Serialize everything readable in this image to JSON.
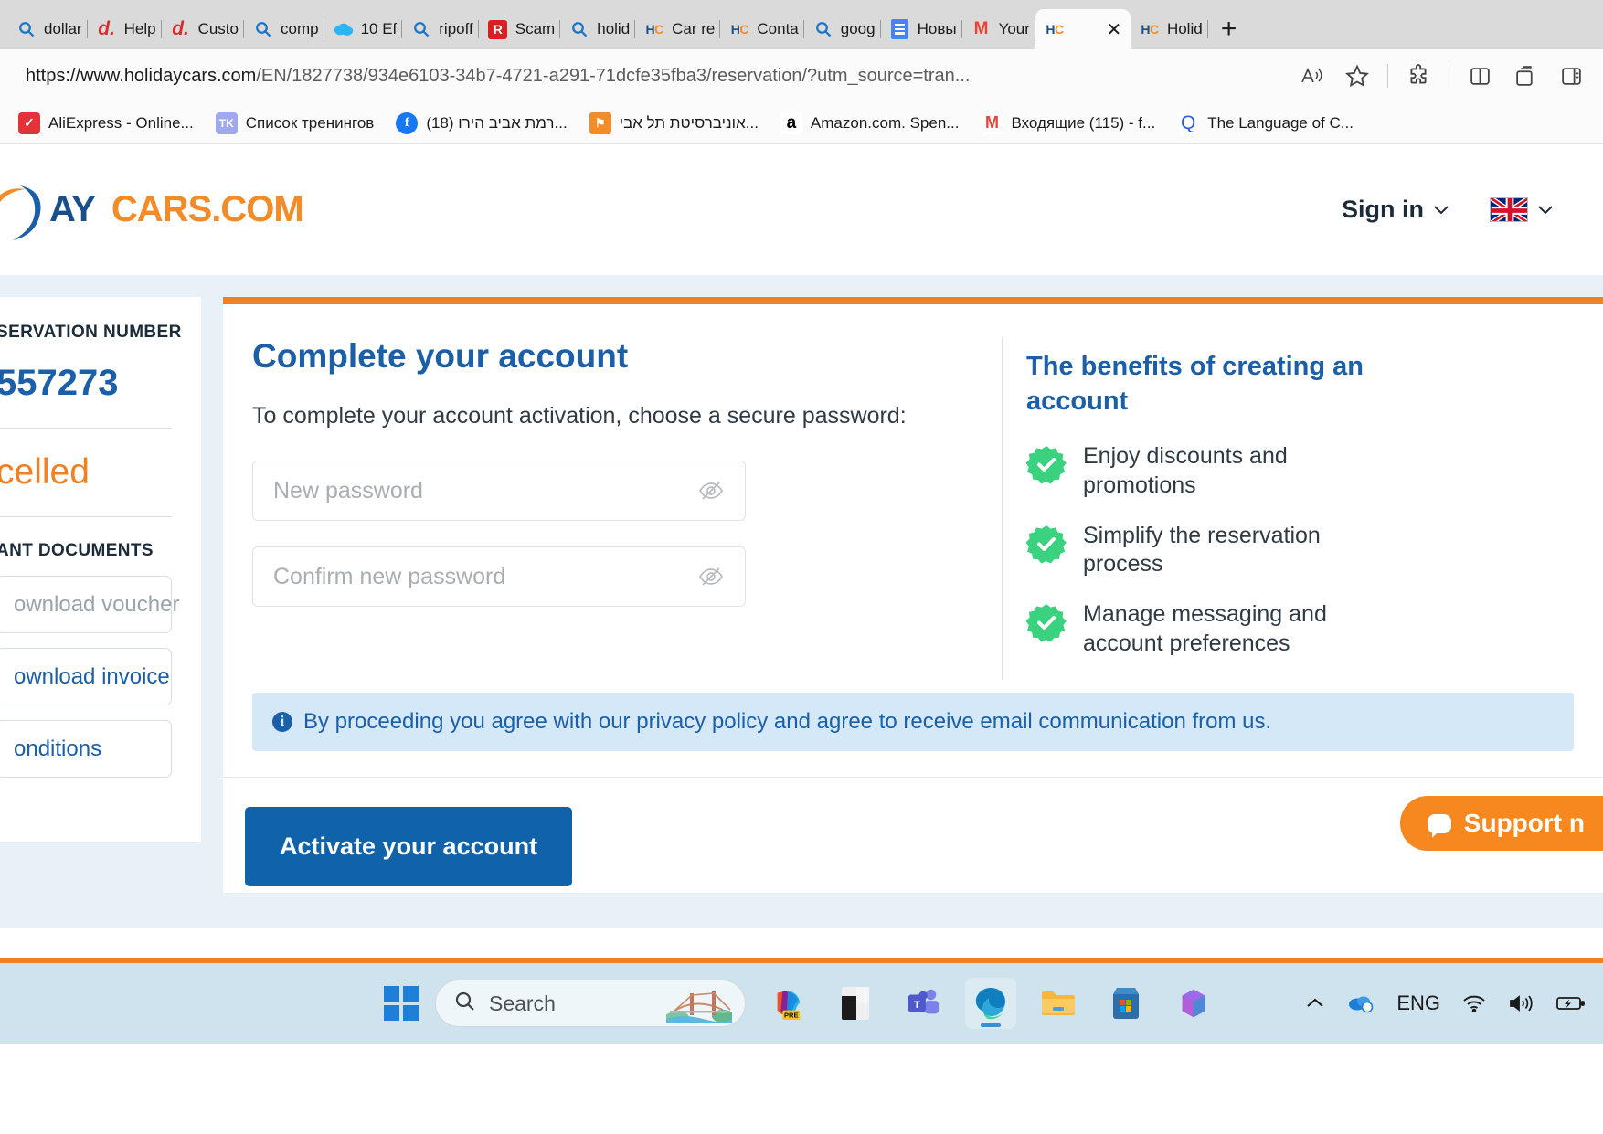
{
  "browser": {
    "tabs": [
      {
        "favicon": "search-icon",
        "title": "dollar"
      },
      {
        "favicon": "dafont-icon",
        "title": "Help"
      },
      {
        "favicon": "dafont-icon",
        "title": "Custo"
      },
      {
        "favicon": "search-icon",
        "title": "comp"
      },
      {
        "favicon": "cloud-icon",
        "title": "10 Ef"
      },
      {
        "favicon": "search-icon",
        "title": "ripoff"
      },
      {
        "favicon": "ripoffreport-icon",
        "title": "Scam"
      },
      {
        "favicon": "search-icon",
        "title": "holid"
      },
      {
        "favicon": "holidaycars-icon",
        "title": "Car re"
      },
      {
        "favicon": "holidaycars-icon",
        "title": "Conta"
      },
      {
        "favicon": "search-icon",
        "title": "goog"
      },
      {
        "favicon": "document-icon",
        "title": "Новы"
      },
      {
        "favicon": "gmail-icon",
        "title": "Your"
      },
      {
        "favicon": "holidaycars-icon",
        "title": "",
        "active": true,
        "close": "✕"
      },
      {
        "favicon": "holidaycars-icon",
        "title": "Holid"
      }
    ],
    "new_tab_label": "+",
    "url": {
      "scheme_host": "https://www.holidaycars.com",
      "path": "/EN/1827738/934e6103-34b7-4721-a291-71dcfe35fba3/reservation/?utm_source=tran..."
    },
    "toolbar_icons": [
      "read-aloud-icon",
      "favorite-star-icon",
      "extensions-icon",
      "split-screen-icon",
      "collections-icon",
      "browser-essentials-icon"
    ],
    "bookmarks": [
      {
        "icon": "aliexpress-icon",
        "icon_text": "✓",
        "label": "AliExpress - Online..."
      },
      {
        "icon": "tk-icon",
        "icon_text": "TK",
        "label": "Список тренингов"
      },
      {
        "icon": "facebook-icon",
        "icon_text": "f",
        "label": "(18) רמת אביב הירו..."
      },
      {
        "icon": "mortarboard-icon",
        "icon_text": "⚑",
        "label": "אוניברסיטת תל אבי..."
      },
      {
        "icon": "amazon-icon",
        "icon_text": "a",
        "label": "Amazon.com. Spen..."
      },
      {
        "icon": "gmail-icon",
        "icon_text": "M",
        "label": "Входящие (115) - f..."
      },
      {
        "icon": "quora-icon",
        "icon_text": "Q",
        "label": "The Language of C..."
      }
    ]
  },
  "site": {
    "logo_part1": "AY",
    "logo_part2": "CARS.COM",
    "sign_in": "Sign in",
    "sign_in_caret": "⌄",
    "lang_caret": "⌄"
  },
  "sidebar": {
    "reservation_label": "SERVATION NUMBER",
    "reservation_number": "557273",
    "status": "celled",
    "documents_label": "ANT DOCUMENTS",
    "buttons": [
      {
        "label": "ownload voucher",
        "style": "muted"
      },
      {
        "label": "ownload invoice",
        "style": "linkish"
      },
      {
        "label": "onditions",
        "style": "linkish"
      }
    ]
  },
  "main": {
    "title": "Complete your account",
    "subtitle": "To complete your account activation, choose a secure password:",
    "new_password_placeholder": "New password",
    "confirm_password_placeholder": "Confirm new password",
    "benefits_title": "The benefits of creating an account",
    "benefits": [
      "Enjoy discounts and promotions",
      "Simplify the reservation process",
      "Manage messaging and account preferences"
    ],
    "notice": "By proceeding you agree with our privacy policy and agree to receive email communication from us.",
    "activate_button": "Activate your account",
    "support_chip": "Support n"
  },
  "taskbar": {
    "search_placeholder": "Search",
    "apps": [
      "copilot-icon",
      "dark-app-icon",
      "teams-icon",
      "edge-icon",
      "file-explorer-icon",
      "microsoft-store-icon",
      "office-icon"
    ],
    "tray": {
      "chevron": "⌃",
      "onedrive": "onedrive-icon",
      "language": "ENG",
      "wifi": "wifi-icon",
      "volume": "volume-icon",
      "battery": "battery-charging-icon"
    }
  },
  "colors": {
    "brand_blue": "#1a5fa8",
    "brand_orange": "#f08022",
    "accent_green": "#3ad17f",
    "notice_bg": "#d5e8f7",
    "button_blue": "#1063a8"
  }
}
